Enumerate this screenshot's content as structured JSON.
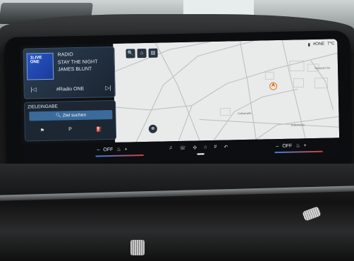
{
  "media": {
    "type": "RADIO",
    "title": "STAY THE NIGHT",
    "artist": "JAMES BLUNT",
    "station": "#Radio ONE",
    "album_label": "1LIVE\nONE",
    "prev_icon": "skip-previous-icon",
    "next_icon": "skip-next-icon"
  },
  "navigation": {
    "heading": "ZIELEINGABE",
    "search_label": "Ziel suchen",
    "icons": [
      "flag-icon",
      "parking-icon",
      "fuel-icon"
    ],
    "icon_glyphs": [
      "⚑",
      "P",
      "⛽"
    ]
  },
  "map_toolbar": {
    "buttons": [
      "search-icon",
      "home-icon",
      "document-icon"
    ],
    "glyphs": [
      "🔍",
      "⌂",
      "▤"
    ]
  },
  "status": {
    "station": "#ONE",
    "temperature": "7°C"
  },
  "map_labels": [
    "Spessart Str.",
    "Kolbstraße",
    "Kolbstraße"
  ],
  "climate": {
    "left": {
      "minus": "–",
      "fan": "OFF",
      "plus": "+"
    },
    "right": {
      "minus": "–",
      "fan": "OFF",
      "plus": "+"
    }
  },
  "dock_glyphs": [
    "♫",
    "☏",
    "✣",
    "⌂",
    "#",
    "↶"
  ],
  "colors": {
    "card_bg": "#1d2733",
    "accent": "#3a6b9b",
    "map_bg": "#e9eaea",
    "heat": "#d83d3d",
    "cool": "#3f7be0"
  }
}
